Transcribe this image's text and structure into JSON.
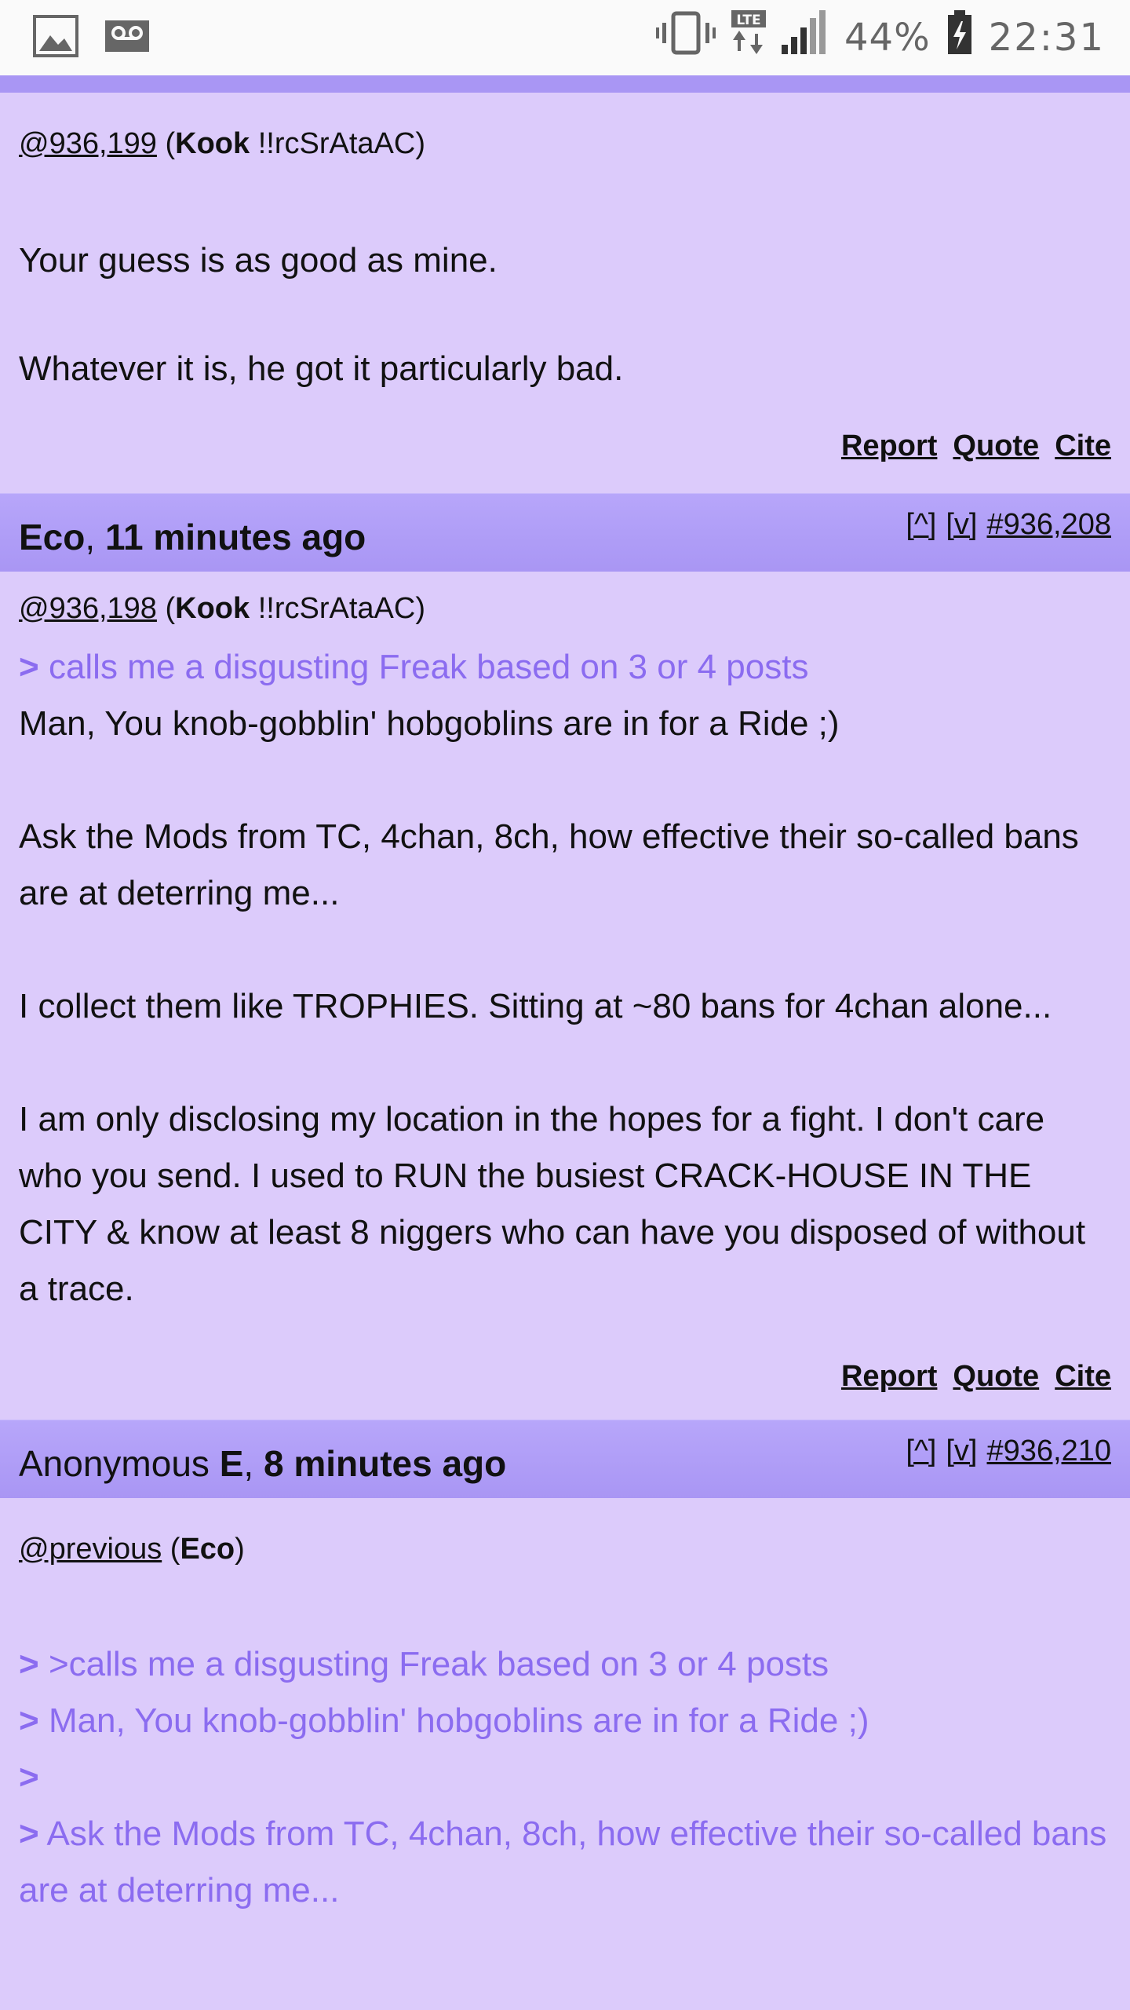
{
  "status_bar": {
    "battery_percent": "44%",
    "time": "22:31",
    "network": "LTE",
    "left_icons": [
      "image-notification-icon",
      "voicemail-icon"
    ],
    "right_icons": [
      "vibrate-icon",
      "lte-data-icon",
      "signal-icon",
      "battery-charging-icon"
    ]
  },
  "post1": {
    "ref": "@936,199",
    "ref_author": "Kook",
    "ref_trip": "!!rcSrAtaAC",
    "lines": [
      "Your guess is as good as mine.",
      "Whatever it is, he got it particularly bad."
    ]
  },
  "post2": {
    "author": "Eco",
    "time_ago": "11 minutes ago",
    "nav_up": "[^]",
    "nav_down": "[v]",
    "post_number": "#936,208",
    "ref": "@936,198",
    "ref_author": "Kook",
    "ref_trip": "!!rcSrAtaAC",
    "quote_marker": ">",
    "quote_text": "calls me a disgusting Freak based on 3 or 4 posts",
    "para1": "Man, You knob-gobblin' hobgoblins are in for a Ride ;)",
    "para2": "Ask the Mods from TC, 4chan, 8ch, how effective their so-called bans are at deterring me...",
    "para3": "I collect them like TROPHIES. Sitting at ~80 bans for 4chan alone...",
    "para4": "I am only disclosing my location in the hopes for a fight. I don't care who you send. I used to RUN the busiest CRACK-HOUSE IN THE CITY & know at least 8 niggers who can have you disposed of without a trace."
  },
  "post3": {
    "author": "Anonymous",
    "author_suffix": "E",
    "time_ago": "8 minutes ago",
    "nav_up": "[^]",
    "nav_down": "[v]",
    "post_number": "#936,210",
    "ref": "@previous",
    "ref_author": "Eco",
    "quote_marker": ">",
    "quote_lines": [
      ">calls me a disgusting Freak based on 3 or 4 posts",
      "Man, You knob-gobblin' hobgoblins are in for a Ride ;)",
      "",
      "Ask the Mods from TC, 4chan, 8ch, how effective their so-called bans are at deterring me..."
    ]
  },
  "actions": {
    "report": "Report",
    "quote": "Quote",
    "cite": "Cite"
  },
  "colors": {
    "background": "#dccbfb",
    "header": "#a996f4",
    "quote": "#8b6cf0"
  }
}
